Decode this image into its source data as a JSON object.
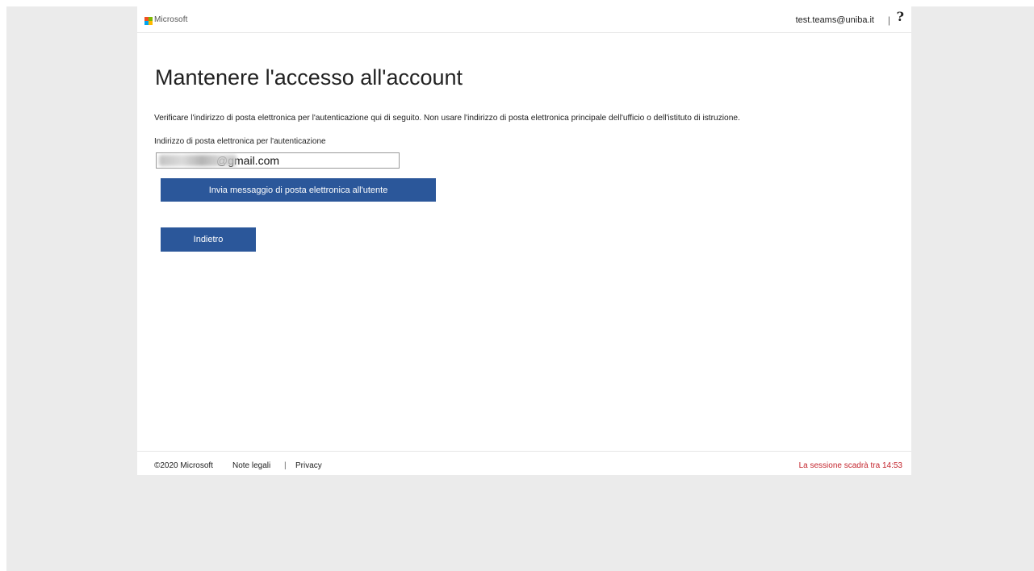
{
  "header": {
    "brand": "Microsoft",
    "user_email": "test.teams@uniba.it",
    "separator": "|",
    "help": "?",
    "logo_colors": [
      "#f25022",
      "#7fba00",
      "#00a4ef",
      "#ffb900"
    ]
  },
  "main": {
    "title": "Mantenere l'accesso all'account",
    "description": "Verificare l'indirizzo di posta elettronica per l'autenticazione qui di seguito. Non usare l'indirizzo di posta elettronica principale dell'ufficio o dell'istituto di istruzione.",
    "field_label": "Indirizzo di posta elettronica per l'autenticazione",
    "email_value": "                  @gmail.com",
    "send_button": "Invia messaggio di posta elettronica all'utente",
    "back_button": "Indietro"
  },
  "footer": {
    "copyright": "©2020 Microsoft",
    "legal": "Note legali",
    "separator": "|",
    "privacy": "Privacy",
    "session": "La sessione scadrà tra 14:53"
  },
  "colors": {
    "accent": "#2b579a",
    "timer": "#c4262e",
    "backdrop": "#ebebeb"
  }
}
